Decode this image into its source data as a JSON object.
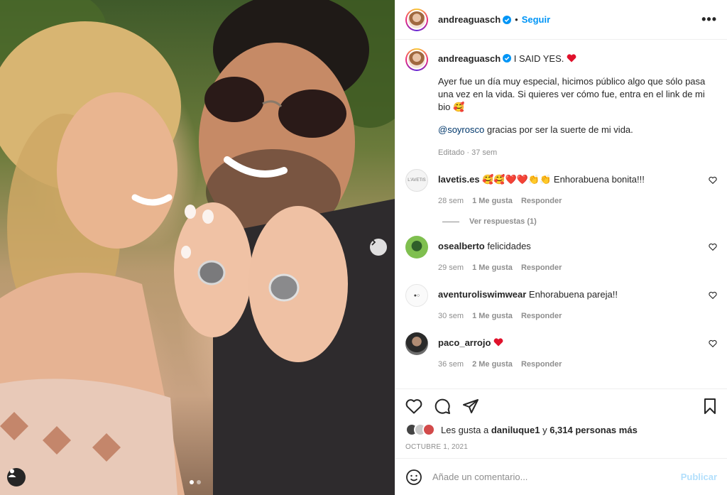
{
  "author": {
    "username": "andreaguasch",
    "follow_label": "Seguir",
    "separator": "•",
    "more_label": "•••"
  },
  "caption": {
    "username": "andreaguasch",
    "line1": "I SAID YES.",
    "paragraph": "Ayer fue un día muy especial, hicimos público algo que sólo pasa una vez en la vida. Si quieres ver cómo fue, entra en el link de mi bio",
    "emoji": "🥰",
    "mention": "@soyrosco",
    "mention_text": "gracias por ser la suerte de mi vida.",
    "edited_meta": "Editado · 37 sem"
  },
  "comments": [
    {
      "user": "lavetis.es",
      "text": "🥰🥰❤️❤️👏👏 Enhorabuena bonita!!!",
      "time": "28 sem",
      "likes": "1 Me gusta",
      "reply": "Responder",
      "avatar_color": "#f2f2f2"
    },
    {
      "user": "osealberto",
      "text": "felicidades",
      "time": "29 sem",
      "likes": "1 Me gusta",
      "reply": "Responder",
      "avatar_color": "#6aa84f"
    },
    {
      "user": "aventuroliswimwear",
      "text": "Enhorabuena pareja!!",
      "time": "30 sem",
      "likes": "1 Me gusta",
      "reply": "Responder",
      "avatar_color": "#fafafa"
    },
    {
      "user": "paco_arrojo",
      "text": "❤️",
      "time": "36 sem",
      "likes": "2 Me gusta",
      "reply": "Responder",
      "avatar_color": "#3a3a3a"
    }
  ],
  "view_replies": "Ver respuestas (1)",
  "likes": {
    "prefix": "Les gusta a",
    "user": "daniluque1",
    "middle": "y",
    "count": "6,314 personas más"
  },
  "date": "OCTUBRE 1, 2021",
  "add_comment": {
    "placeholder": "Añade un comentario...",
    "publish_label": "Publicar"
  },
  "colors": {
    "accent": "#0095f6",
    "heart": "#ed4956",
    "muted": "#8e8e8e"
  }
}
